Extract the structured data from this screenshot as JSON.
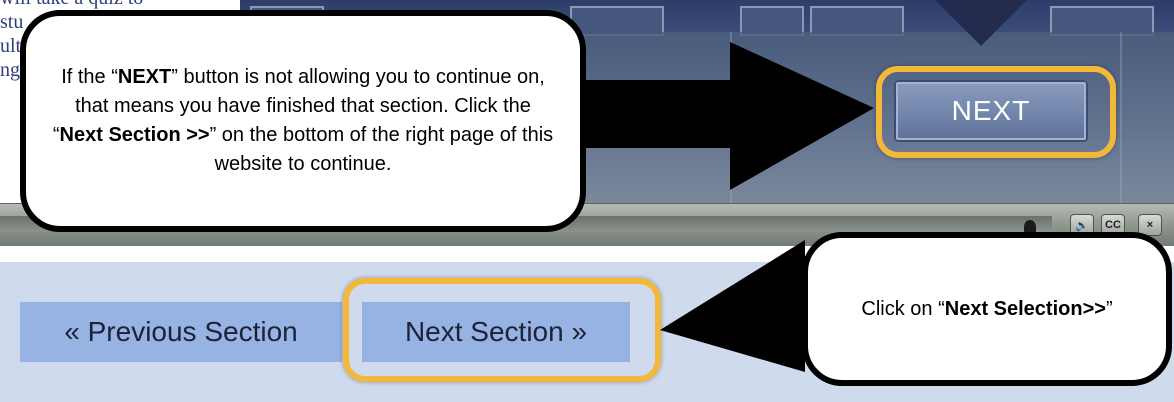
{
  "course": {
    "partial_text": "will take a quiz to\nstu\nult\nng."
  },
  "player": {
    "next_label": "NEXT",
    "controls": [
      {
        "name": "volume-button",
        "icon": "speaker-icon",
        "glyph": "🔈"
      },
      {
        "name": "captions-button",
        "icon": "cc-icon",
        "glyph": "CC"
      },
      {
        "name": "close-player-button",
        "icon": "close-icon",
        "glyph": "×"
      }
    ]
  },
  "site_nav": {
    "previous_label": "« Previous Section",
    "next_label": "Next Section »"
  },
  "callouts": {
    "top": {
      "part1": "If the “",
      "bold1": "NEXT",
      "part2": "” button is not allowing you to continue on, that means you have finished that section. Click the “",
      "bold2": "Next Section >>",
      "part3": "” on the bottom of the right page of this website to continue."
    },
    "bottom": {
      "part1": "Click on “",
      "bold1": "Next Selection>>",
      "part2": "”"
    }
  },
  "colors": {
    "highlight": "#f1b83a",
    "nav_button": "#97b3e3",
    "nav_background": "#cfdaed",
    "callout_border": "#000000"
  }
}
